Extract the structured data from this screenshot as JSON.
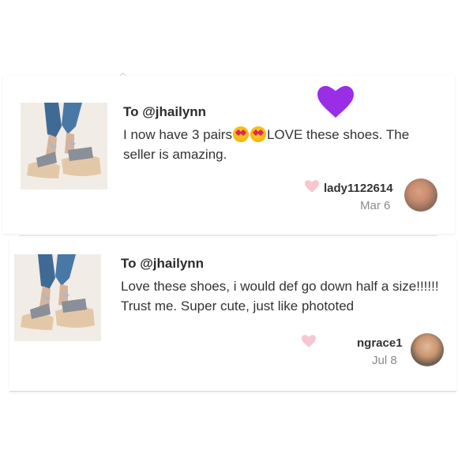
{
  "comments": [
    {
      "to": "To @jhailynn",
      "message_part1": "I now have 3 pairs",
      "message_part2": "LOVE these shoes. The seller is amazing.",
      "username": "lady1122614",
      "date": "Mar 6"
    },
    {
      "to": "To @jhailynn",
      "message": "Love these shoes, i would def go down half a size!!!!!! Trust me. Super cute, just like phototed",
      "username": "ngrace1",
      "date": "Jul 8"
    }
  ],
  "icons": {
    "like": "heart-icon",
    "emoji": "heart-eyes-emoji",
    "sticker": "purple-heart-icon"
  },
  "colors": {
    "like_heart": "#f7c6d0",
    "purple_heart": "#9b2de6",
    "text": "#333333",
    "muted": "#8a8a8a"
  }
}
